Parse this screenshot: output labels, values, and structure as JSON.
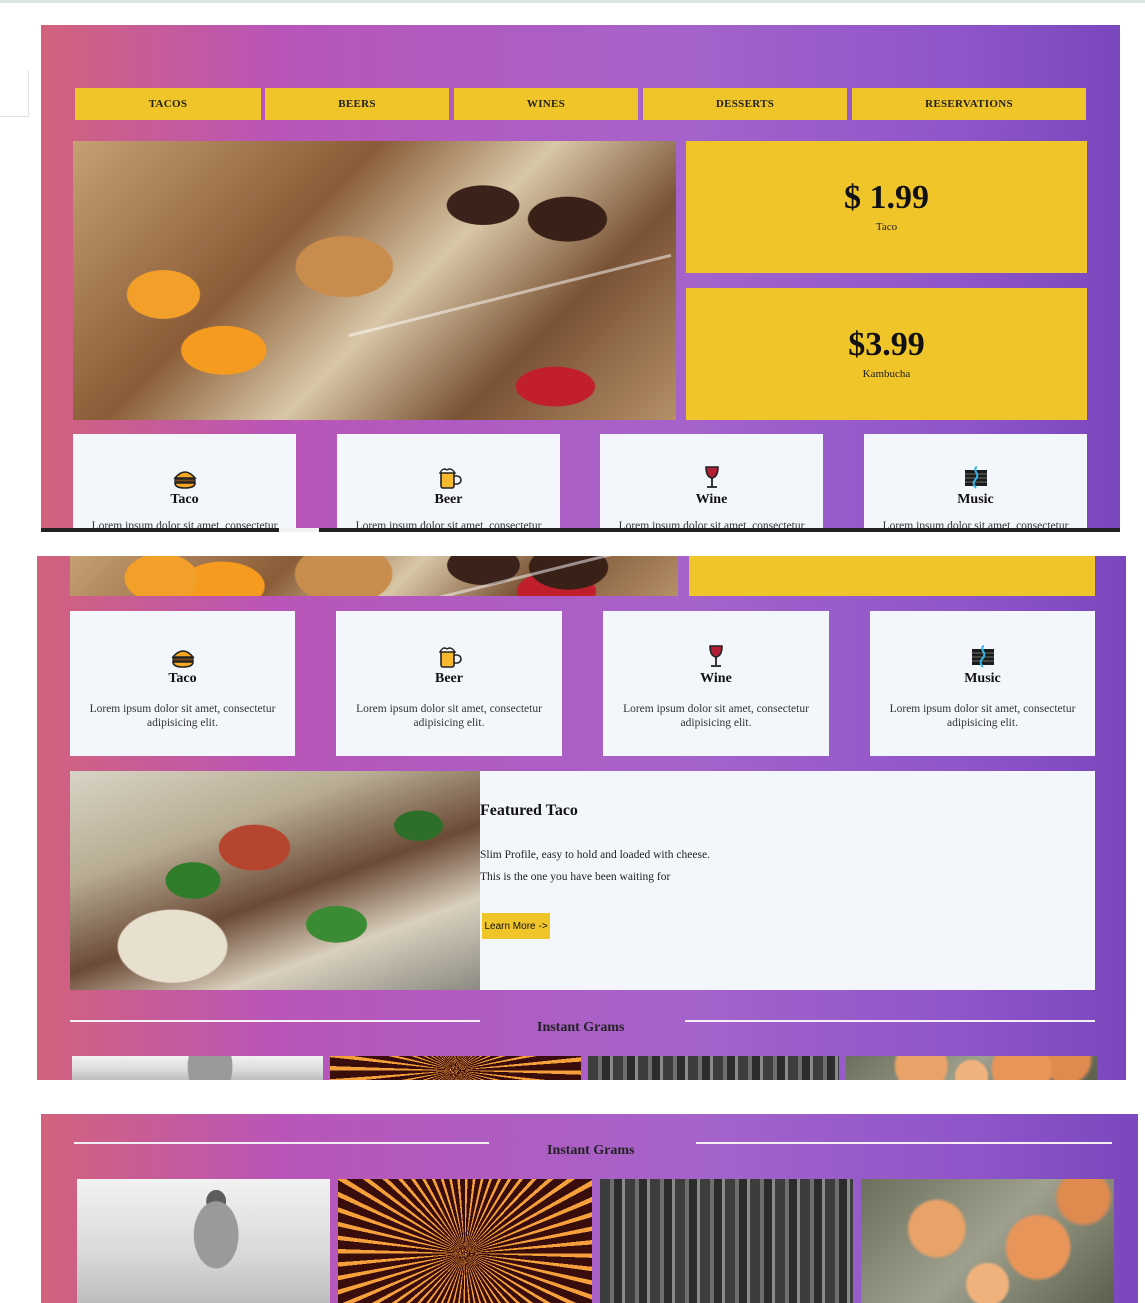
{
  "nav": {
    "tacos": "TACOS",
    "beers": "BEERS",
    "wines": "WINES",
    "desserts": "DESSERTS",
    "reservations": "RESERVATIONS"
  },
  "prices": [
    {
      "amount": "$ 1.99",
      "label": "Taco"
    },
    {
      "amount": "$3.99",
      "label": "Kambucha"
    }
  ],
  "cards": [
    {
      "title": "Taco",
      "icon": "burger-icon",
      "text": "Lorem ipsum dolor sit amet, consectetur adipisicing elit."
    },
    {
      "title": "Beer",
      "icon": "beer-mug-icon",
      "text": "Lorem ipsum dolor sit amet, consectetur adipisicing elit."
    },
    {
      "title": "Wine",
      "icon": "wine-glass-icon",
      "text": "Lorem ipsum dolor sit amet, consectetur adipisicing elit."
    },
    {
      "title": "Music",
      "icon": "music-clef-icon",
      "text": "Lorem ipsum dolor sit amet, consectetur adipisicing elit."
    }
  ],
  "cards_cropped_text": "Lorem ipsum dolor sit amet, consectetur",
  "featured": {
    "title": "Featured Taco",
    "line1": "Slim Profile, easy to hold and loaded with cheese.",
    "line2": "This is the one you have been waiting for",
    "button": "Learn More ->"
  },
  "grams": {
    "title": "Instant Grams",
    "images": [
      "bride-photo",
      "fireworks-photo",
      "city-aerial-photo",
      "frosted-flowers-photo"
    ]
  },
  "colors": {
    "accent": "#f0c52a",
    "gradient_start": "#d2627c",
    "gradient_mid": "#a563cb",
    "gradient_end": "#7b47bd",
    "card_bg": "#f3f6fb"
  }
}
